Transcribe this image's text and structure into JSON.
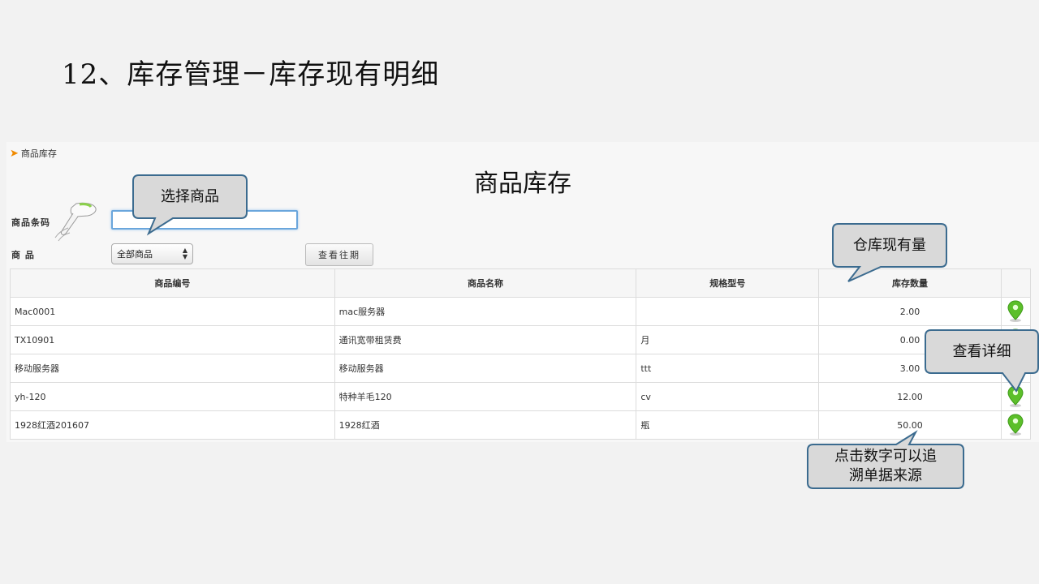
{
  "slide_title": "12、库存管理－库存现有明细",
  "breadcrumb": "商品库存",
  "page_heading": "商品库存",
  "form": {
    "barcode_label": "商品条码",
    "barcode_value": "",
    "product_label": "商 品",
    "product_select": "全部商品",
    "history_button": "查看往期"
  },
  "table": {
    "headers": [
      "商品编号",
      "商品名称",
      "规格型号",
      "库存数量",
      ""
    ],
    "rows": [
      {
        "code": "Mac0001",
        "name": "mac服务器",
        "spec": "",
        "qty": "2.00"
      },
      {
        "code": "TX10901",
        "name": "通讯宽带租赁费",
        "spec": "月",
        "qty": "0.00"
      },
      {
        "code": "移动服务器",
        "name": "移动服务器",
        "spec": "ttt",
        "qty": "3.00"
      },
      {
        "code": "yh-120",
        "name": "特种羊毛120",
        "spec": "cv",
        "qty": "12.00"
      },
      {
        "code": "1928红酒201607",
        "name": "1928红酒",
        "spec": "瓶",
        "qty": "50.00"
      }
    ],
    "action_icon": "map-pin-icon"
  },
  "callouts": {
    "select_product": "选择商品",
    "warehouse_stock": "仓库现有量",
    "view_detail": "查看详细",
    "trace_line1": "点击数字可以追",
    "trace_line2": "溯单据来源"
  },
  "colors": {
    "callout_fill": "#d9d9d9",
    "callout_border": "#3b6b8f",
    "pin_green": "#5cbf2a",
    "input_focus": "#6aa6dc",
    "breadcrumb_arrow": "#f08a00"
  }
}
